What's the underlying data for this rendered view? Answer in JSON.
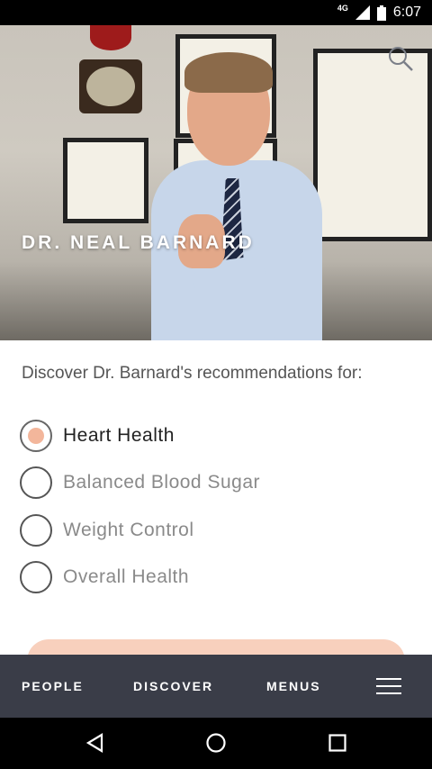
{
  "status_bar": {
    "network": "4G",
    "time": "6:07"
  },
  "hero": {
    "title": "DR. NEAL BARNARD"
  },
  "intro_text": "Discover Dr. Barnard's recommendations for:",
  "options": [
    {
      "label": "Heart Health",
      "selected": true
    },
    {
      "label": "Balanced Blood Sugar",
      "selected": false
    },
    {
      "label": "Weight Control",
      "selected": false
    },
    {
      "label": "Overall Health",
      "selected": false
    }
  ],
  "bottom_nav": {
    "people": "PEOPLE",
    "discover": "DISCOVER",
    "menus": "MENUS"
  },
  "colors": {
    "accent": "#f3b69b",
    "nav_bg": "#3a3d48"
  },
  "icons": [
    "search-icon",
    "menu-icon",
    "back-icon",
    "home-icon",
    "recents-icon"
  ]
}
